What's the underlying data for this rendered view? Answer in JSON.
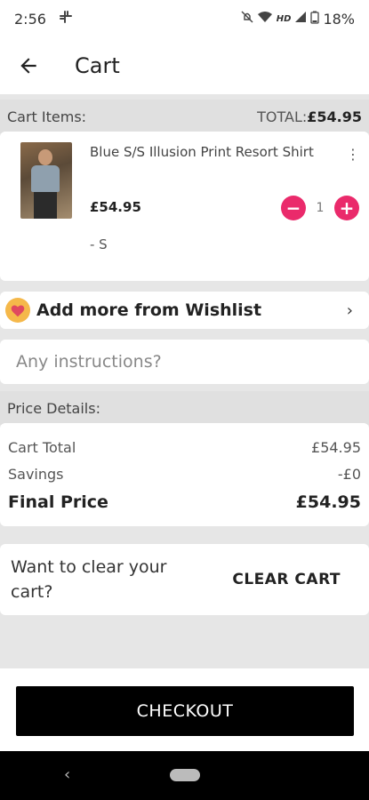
{
  "status_bar": {
    "time": "2:56",
    "battery": "18%",
    "icons": [
      "slack-icon",
      "mute-icon",
      "wifi-icon",
      "hd-icon",
      "signal-icon",
      "battery-icon"
    ]
  },
  "app_bar": {
    "title": "Cart",
    "back_icon": "arrow-back-icon"
  },
  "cart_header": {
    "label": "Cart Items:",
    "total_label": "TOTAL:",
    "total_value": "£54.95"
  },
  "cart_item": {
    "name": "Blue S/S Illusion Print Resort Shirt",
    "price": "£54.95",
    "quantity": "1",
    "size": "- S",
    "minus_label": "−",
    "plus_label": "+",
    "more_label": "⋮"
  },
  "wishlist": {
    "label": "Add more from Wishlist",
    "chevron": "›"
  },
  "instructions": {
    "placeholder": "Any instructions?"
  },
  "price_header": {
    "label": "Price Details:"
  },
  "price_details": {
    "cart_total_label": "Cart Total",
    "cart_total_value": "£54.95",
    "savings_label": "Savings",
    "savings_value": "-£0",
    "final_label": "Final Price",
    "final_value": "£54.95"
  },
  "clear_cart": {
    "prompt": "Want to clear your cart?",
    "button": "CLEAR CART"
  },
  "checkout": {
    "button": "CHECKOUT"
  },
  "nav_bar": {
    "back_glyph": "‹"
  },
  "colors": {
    "accent": "#ea2a6b",
    "wishlist_badge": "#f5b84a",
    "checkout_bg": "#000000"
  }
}
